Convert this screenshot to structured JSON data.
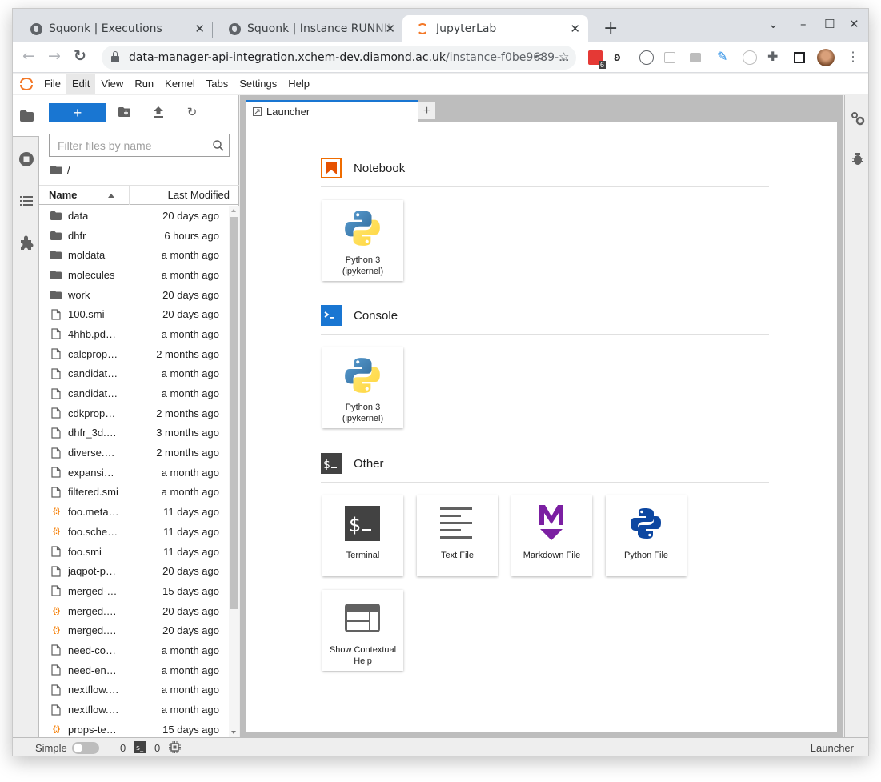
{
  "browser": {
    "tabs": [
      {
        "title": "Squonk | Executions",
        "icon": "globe-icon"
      },
      {
        "title": "Squonk | Instance RUNNING",
        "icon": "globe-icon"
      },
      {
        "title": "JupyterLab",
        "icon": "jupyter-icon",
        "active": true
      }
    ],
    "new_tab_label": "+",
    "url_host": "data-manager-api-integration.xchem-dev.diamond.ac.uk",
    "url_path": "/instance-f0be9689-...",
    "extension_badge": "6",
    "window_controls": {
      "list": "⌄",
      "minimize": "–",
      "maximize": "☐",
      "close": "✕"
    }
  },
  "menubar": {
    "items": [
      "File",
      "Edit",
      "View",
      "Run",
      "Kernel",
      "Tabs",
      "Settings",
      "Help"
    ]
  },
  "filebrowser": {
    "new_button_label": "+",
    "filter_placeholder": "Filter files by name",
    "filter_value": "",
    "breadcrumb": "/",
    "columns": {
      "name": "Name",
      "modified": "Last Modified"
    },
    "files": [
      {
        "name": "data",
        "type": "folder",
        "modified": "20 days ago"
      },
      {
        "name": "dhfr",
        "type": "folder",
        "modified": "6 hours ago"
      },
      {
        "name": "moldata",
        "type": "folder",
        "modified": "a month ago"
      },
      {
        "name": "molecules",
        "type": "folder",
        "modified": "a month ago"
      },
      {
        "name": "work",
        "type": "folder",
        "modified": "20 days ago"
      },
      {
        "name": "100.smi",
        "type": "file",
        "modified": "20 days ago"
      },
      {
        "name": "4hhb.pd…",
        "type": "file",
        "modified": "a month ago"
      },
      {
        "name": "calcprop…",
        "type": "file",
        "modified": "2 months ago"
      },
      {
        "name": "candidat…",
        "type": "file",
        "modified": "a month ago"
      },
      {
        "name": "candidat…",
        "type": "file",
        "modified": "a month ago"
      },
      {
        "name": "cdkprop…",
        "type": "file",
        "modified": "2 months ago"
      },
      {
        "name": "dhfr_3d.…",
        "type": "file",
        "modified": "3 months ago"
      },
      {
        "name": "diverse.…",
        "type": "file",
        "modified": "2 months ago"
      },
      {
        "name": "expansi…",
        "type": "file",
        "modified": "a month ago"
      },
      {
        "name": "filtered.smi",
        "type": "file",
        "modified": "a month ago"
      },
      {
        "name": "foo.meta…",
        "type": "json",
        "modified": "11 days ago"
      },
      {
        "name": "foo.sche…",
        "type": "json",
        "modified": "11 days ago"
      },
      {
        "name": "foo.smi",
        "type": "file",
        "modified": "11 days ago"
      },
      {
        "name": "jaqpot-p…",
        "type": "file",
        "modified": "20 days ago"
      },
      {
        "name": "merged-…",
        "type": "file",
        "modified": "15 days ago"
      },
      {
        "name": "merged.…",
        "type": "json",
        "modified": "20 days ago"
      },
      {
        "name": "merged.…",
        "type": "json",
        "modified": "20 days ago"
      },
      {
        "name": "need-co…",
        "type": "file",
        "modified": "a month ago"
      },
      {
        "name": "need-en…",
        "type": "file",
        "modified": "a month ago"
      },
      {
        "name": "nextflow.…",
        "type": "file",
        "modified": "a month ago"
      },
      {
        "name": "nextflow.…",
        "type": "file",
        "modified": "a month ago"
      },
      {
        "name": "props-te…",
        "type": "json",
        "modified": "15 days ago"
      }
    ]
  },
  "dock": {
    "tab_label": "Launcher",
    "add_label": "+"
  },
  "launcher": {
    "sections": [
      {
        "title": "Notebook",
        "icon": "notebook-icon",
        "cards": [
          {
            "label": "Python 3 (ipykernel)",
            "icon": "python-logo-icon"
          }
        ]
      },
      {
        "title": "Console",
        "icon": "console-icon",
        "cards": [
          {
            "label": "Python 3 (ipykernel)",
            "icon": "python-logo-icon"
          }
        ]
      },
      {
        "title": "Other",
        "icon": "terminal-icon",
        "cards": [
          {
            "label": "Terminal",
            "icon": "terminal-icon"
          },
          {
            "label": "Text File",
            "icon": "text-file-icon"
          },
          {
            "label": "Markdown File",
            "icon": "markdown-icon"
          },
          {
            "label": "Python File",
            "icon": "python-file-icon"
          },
          {
            "label": "Show Contextual Help",
            "icon": "contextual-help-icon"
          }
        ]
      }
    ]
  },
  "statusbar": {
    "mode_label": "Simple",
    "simple_mode_on": false,
    "terminals_count": "0",
    "kernels_count": "0",
    "current_activity": "Launcher"
  },
  "colors": {
    "accent": "#1976d2",
    "jupyter_orange": "#f37726",
    "notebook_orange": "#e65100",
    "markdown_purple": "#7b1fa2",
    "json_orange": "#f57c00"
  }
}
